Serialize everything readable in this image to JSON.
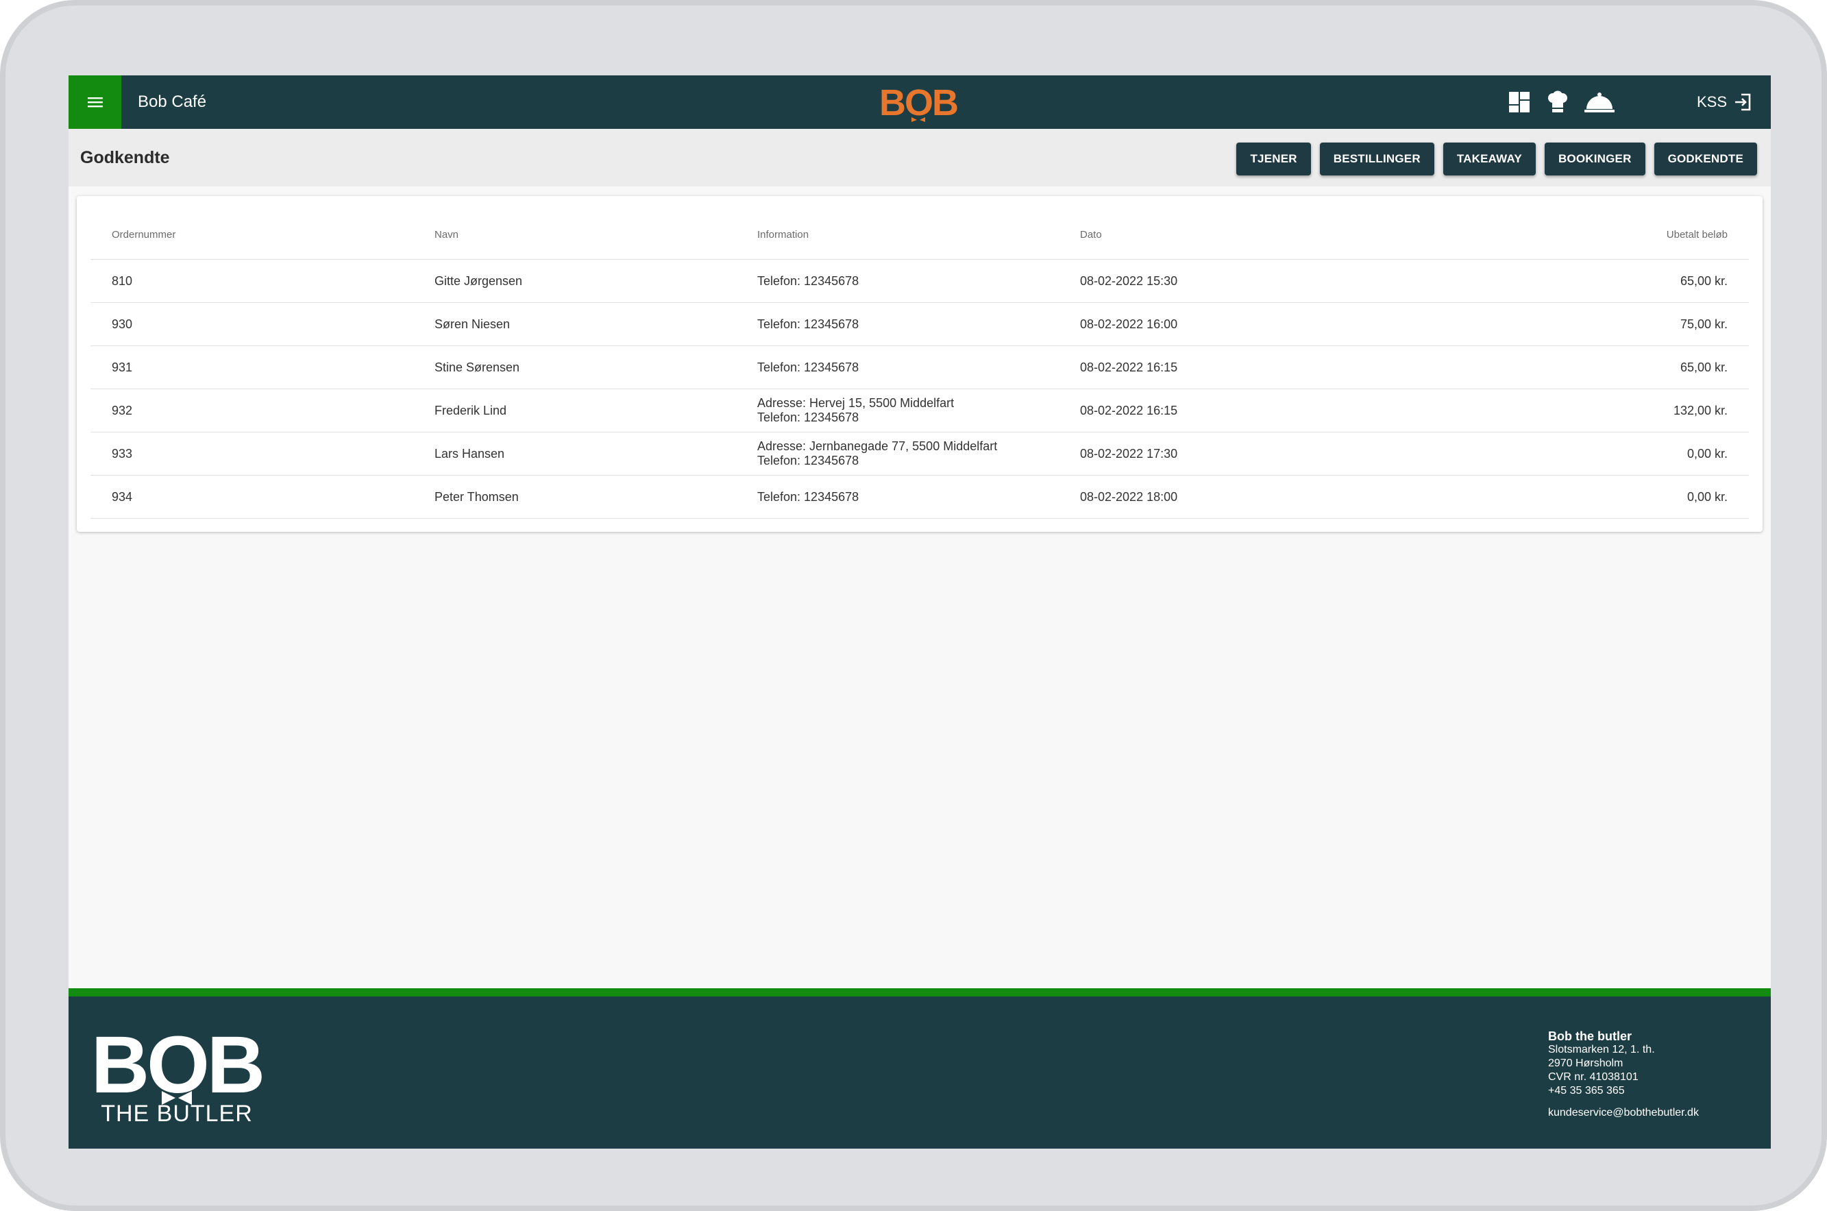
{
  "header": {
    "app_title": "Bob Café",
    "logo_text": "BOB",
    "user_label": "KSS",
    "icons": [
      "dashboard-icon",
      "chef-hat-icon",
      "cloche-icon",
      "logout-icon"
    ]
  },
  "subheader": {
    "page_title": "Godkendte",
    "nav": [
      "TJENER",
      "BESTILLINGER",
      "TAKEAWAY",
      "BOOKINGER",
      "GODKENDTE"
    ]
  },
  "table": {
    "columns": [
      "Ordernummer",
      "Navn",
      "Information",
      "Dato",
      "Ubetalt beløb"
    ],
    "rows": [
      {
        "order": "810",
        "name": "Gitte Jørgensen",
        "info": [
          "Telefon: 12345678"
        ],
        "date": "08-02-2022 15:30",
        "amount": "65,00 kr."
      },
      {
        "order": "930",
        "name": "Søren Niesen",
        "info": [
          "Telefon: 12345678"
        ],
        "date": "08-02-2022 16:00",
        "amount": "75,00 kr."
      },
      {
        "order": "931",
        "name": "Stine Sørensen",
        "info": [
          "Telefon: 12345678"
        ],
        "date": "08-02-2022 16:15",
        "amount": "65,00 kr."
      },
      {
        "order": "932",
        "name": "Frederik Lind",
        "info": [
          "Adresse: Hervej 15, 5500 Middelfart",
          "Telefon: 12345678"
        ],
        "date": "08-02-2022 16:15",
        "amount": "132,00 kr."
      },
      {
        "order": "933",
        "name": "Lars Hansen",
        "info": [
          "Adresse: Jernbanegade 77, 5500 Middelfart",
          "Telefon: 12345678"
        ],
        "date": "08-02-2022 17:30",
        "amount": "0,00 kr."
      },
      {
        "order": "934",
        "name": "Peter Thomsen",
        "info": [
          "Telefon: 12345678"
        ],
        "date": "08-02-2022 18:00",
        "amount": "0,00 kr."
      }
    ]
  },
  "footer": {
    "logo_text": "BOB",
    "logo_subtitle": "THE BUTLER",
    "company_name": "Bob the butler",
    "address_line1": "Slotsmarken 12, 1. th.",
    "address_line2": "2970 Hørsholm",
    "cvr": "CVR nr. 41038101",
    "phone": "+45 35 365 365",
    "email": "kundeservice@bobthebutler.dk"
  },
  "colors": {
    "header_bg": "#1d3d45",
    "accent_green": "#138a10",
    "logo_orange": "#e8762c",
    "button_bg": "#203a44"
  }
}
